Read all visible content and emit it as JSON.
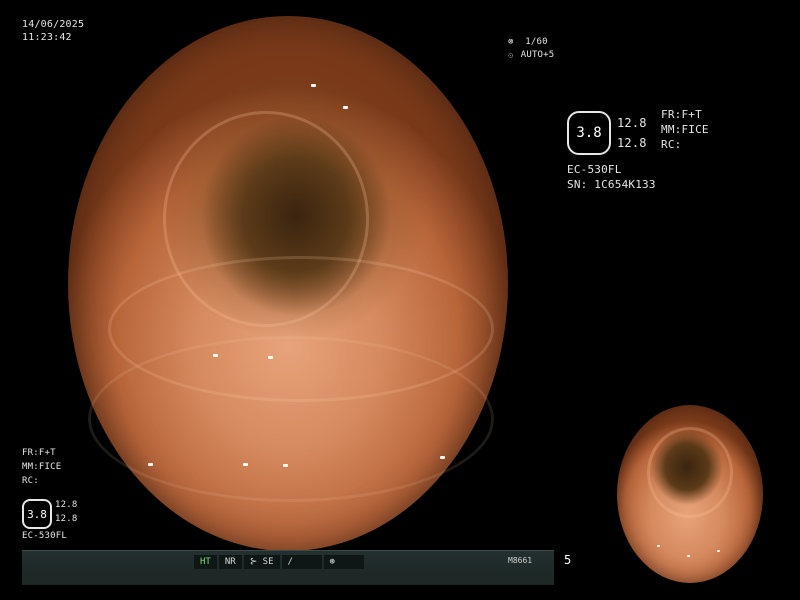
{
  "top_left": {
    "date": "14/06/2025",
    "time": "11:23:42"
  },
  "shutter": {
    "icon": "iris-icon",
    "value": "1/60",
    "auto_icon": "auto-exposure-icon",
    "auto": "AUTO+5"
  },
  "right_panel": {
    "hex_value": "3.8",
    "upper": "12.8",
    "lower": "12.8",
    "fr": "FR:F+T",
    "mm": "MM:FICE",
    "rc": "RC:",
    "model": "EC-530FL",
    "serial": "SN: 1C654K133"
  },
  "left_panel": {
    "fr": "FR:F+T",
    "mm": "MM:FICE",
    "rc": "RC:",
    "hex_value": "3.8",
    "upper": "12.8",
    "lower": "12.8",
    "model": "EC-530FL"
  },
  "status_bar": {
    "segments": [
      "HT",
      "NR",
      "SE",
      "",
      ""
    ],
    "code": "M8661",
    "number": "5"
  },
  "colors": {
    "background": "#000000",
    "text": "#e6e6e6",
    "active": "#7ddc7d",
    "bar": "#1d2827"
  }
}
